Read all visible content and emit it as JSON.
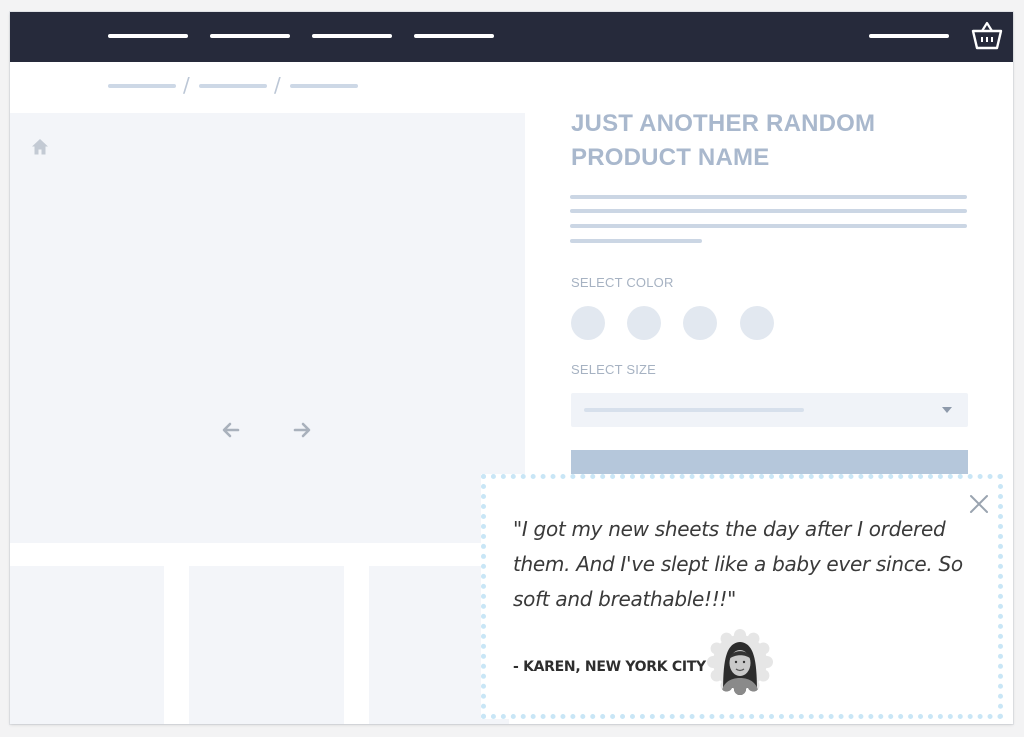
{
  "header": {
    "nav_items": [
      "",
      "",
      "",
      ""
    ],
    "cart_icon": "basket-icon"
  },
  "breadcrumb": {
    "items": [
      "",
      "",
      ""
    ],
    "separators": [
      "/",
      "/"
    ]
  },
  "gallery": {
    "home_icon": "home-icon",
    "prev_icon": "arrow-left-icon",
    "next_icon": "arrow-right-icon"
  },
  "product": {
    "title": "JUST ANOTHER RANDOM PRODUCT NAME",
    "color_label": "SELECT COLOR",
    "size_label": "SELECT SIZE",
    "size_selected": ""
  },
  "testimonial": {
    "quote": "\"I got my new sheets the day after I ordered them. And I've slept like a baby ever since. So soft and breathable!!!\"",
    "author": "- KAREN, NEW YORK CITY",
    "close_icon": "close-icon",
    "avatar": "avatar"
  },
  "colors": {
    "topbar": "#262a3b",
    "placeholder": "#f3f5f9",
    "title": "#a9b8cd",
    "button": "#b5c7db",
    "dotted_border": "#c9e6f6"
  }
}
